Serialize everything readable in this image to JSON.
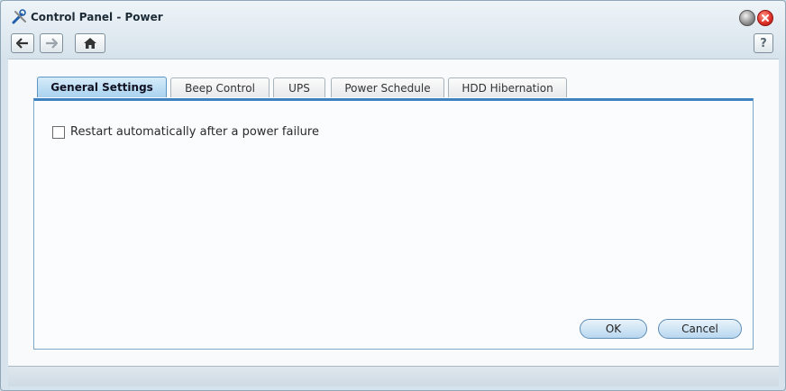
{
  "window": {
    "title": "Control Panel - Power",
    "app_icon": "control-panel-tools-icon"
  },
  "toolbar": {
    "back_icon": "arrow-left-icon",
    "forward_icon": "arrow-right-icon",
    "home_icon": "home-icon",
    "help_label": "?"
  },
  "tabs": [
    {
      "label": "General Settings",
      "active": true
    },
    {
      "label": "Beep Control",
      "active": false
    },
    {
      "label": "UPS",
      "active": false
    },
    {
      "label": "Power Schedule",
      "active": false
    },
    {
      "label": "HDD Hibernation",
      "active": false
    }
  ],
  "general_settings": {
    "restart_option": {
      "label": "Restart automatically after a power failure",
      "checked": false
    }
  },
  "footer": {
    "ok_label": "OK",
    "cancel_label": "Cancel"
  },
  "colors": {
    "accent": "#3e83c0",
    "close": "#e0332b"
  }
}
